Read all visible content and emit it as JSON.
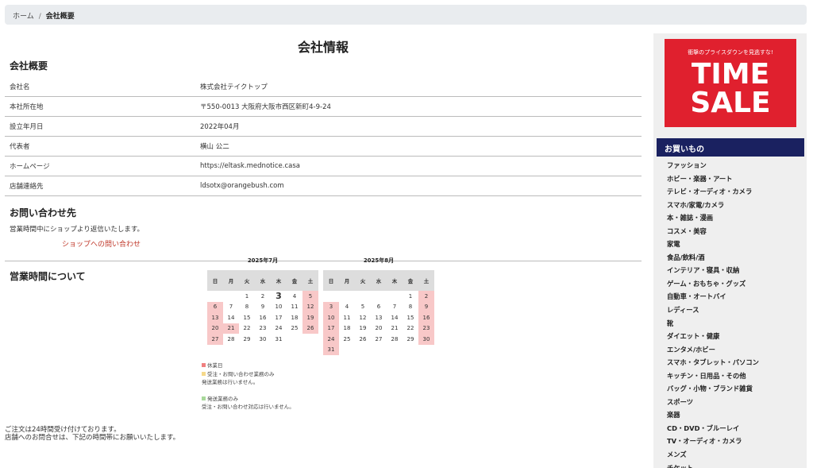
{
  "breadcrumb": {
    "home": "ホーム",
    "sep": "/",
    "current": "会社概要"
  },
  "page_title": "会社情報",
  "company": {
    "heading": "会社概要",
    "rows": [
      {
        "label": "会社名",
        "value": "株式会社テイクトップ"
      },
      {
        "label": "本社所在地",
        "value": "〒550-0013 大阪府大阪市西区新町4-9-24"
      },
      {
        "label": "設立年月日",
        "value": "2022年04月"
      },
      {
        "label": "代表者",
        "value": "横山 公二"
      },
      {
        "label": "ホームページ",
        "value": "https://eltask.mednotice.casa"
      },
      {
        "label": "店舗連絡先",
        "value": "ldsotx@orangebush.com"
      }
    ]
  },
  "contact": {
    "heading": "お問い合わせ先",
    "desc": "営業時間中にショップより返信いたします。",
    "link": "ショップへの問い合わせ"
  },
  "hours": {
    "heading": "営業時間について"
  },
  "calendars": {
    "weekdays": [
      "日",
      "月",
      "火",
      "水",
      "木",
      "金",
      "土"
    ],
    "july": {
      "title": "2025年7月",
      "weeks": [
        [
          "",
          "",
          "1",
          "2",
          "3",
          "4",
          "5"
        ],
        [
          "6",
          "7",
          "8",
          "9",
          "10",
          "11",
          "12"
        ],
        [
          "13",
          "14",
          "15",
          "16",
          "17",
          "18",
          "19"
        ],
        [
          "20",
          "21",
          "22",
          "23",
          "24",
          "25",
          "26"
        ],
        [
          "27",
          "28",
          "29",
          "30",
          "31",
          "",
          ""
        ]
      ],
      "holidays": [
        "5",
        "6",
        "12",
        "13",
        "19",
        "20",
        "21",
        "26",
        "27"
      ],
      "today": "3"
    },
    "august": {
      "title": "2025年8月",
      "weeks": [
        [
          "",
          "",
          "",
          "",
          "",
          "1",
          "2"
        ],
        [
          "3",
          "4",
          "5",
          "6",
          "7",
          "8",
          "9"
        ],
        [
          "10",
          "11",
          "12",
          "13",
          "14",
          "15",
          "16"
        ],
        [
          "17",
          "18",
          "19",
          "20",
          "21",
          "22",
          "23"
        ],
        [
          "24",
          "25",
          "26",
          "27",
          "28",
          "29",
          "30"
        ],
        [
          "31",
          "",
          "",
          "",
          "",
          "",
          ""
        ]
      ],
      "holidays": [
        "2",
        "3",
        "9",
        "10",
        "16",
        "17",
        "23",
        "24",
        "30",
        "31"
      ]
    }
  },
  "legend": {
    "holiday": "休業日",
    "order_only": "受注・お問い合わせ業務のみ",
    "order_only_note": "発送業務は行いません。",
    "ship_only": "発送業務のみ",
    "ship_only_note": "受注・お問い合わせ対応は行いません。",
    "colors": {
      "holiday": "#f08080",
      "order_only": "#f5d98b",
      "ship_only": "#a8d89a"
    }
  },
  "bottom": {
    "line1": "ご注文は24時間受け付けております。",
    "line2": "店舗へのお問合せは、下記の時間帯にお願いいたします。"
  },
  "sidebar": {
    "banner": {
      "sub": "衝撃のプライスダウンを見逃すな!",
      "line1": "TIME",
      "line2": "SALE"
    },
    "shop_heading": "お買いもの",
    "menu": [
      "ファッション",
      "ホビー・楽器・アート",
      "テレビ・オーディオ・カメラ",
      "スマホ/家電/カメラ",
      "本・雑誌・漫画",
      "コスメ・美容",
      "家電",
      "食品/飲料/酒",
      "インテリア・寝具・収納",
      "ゲーム・おもちゃ・グッズ",
      "自動車・オートバイ",
      "レディース",
      "靴",
      "ダイエット・健康",
      "エンタメ/ホビー",
      "スマホ・タブレット・パソコン",
      "キッチン・日用品・その他",
      "バッグ・小物・ブランド雑貨",
      "スポーツ",
      "楽器",
      "CD・DVD・ブルーレイ",
      "TV・オーディオ・カメラ",
      "メンズ",
      "チケット"
    ]
  }
}
